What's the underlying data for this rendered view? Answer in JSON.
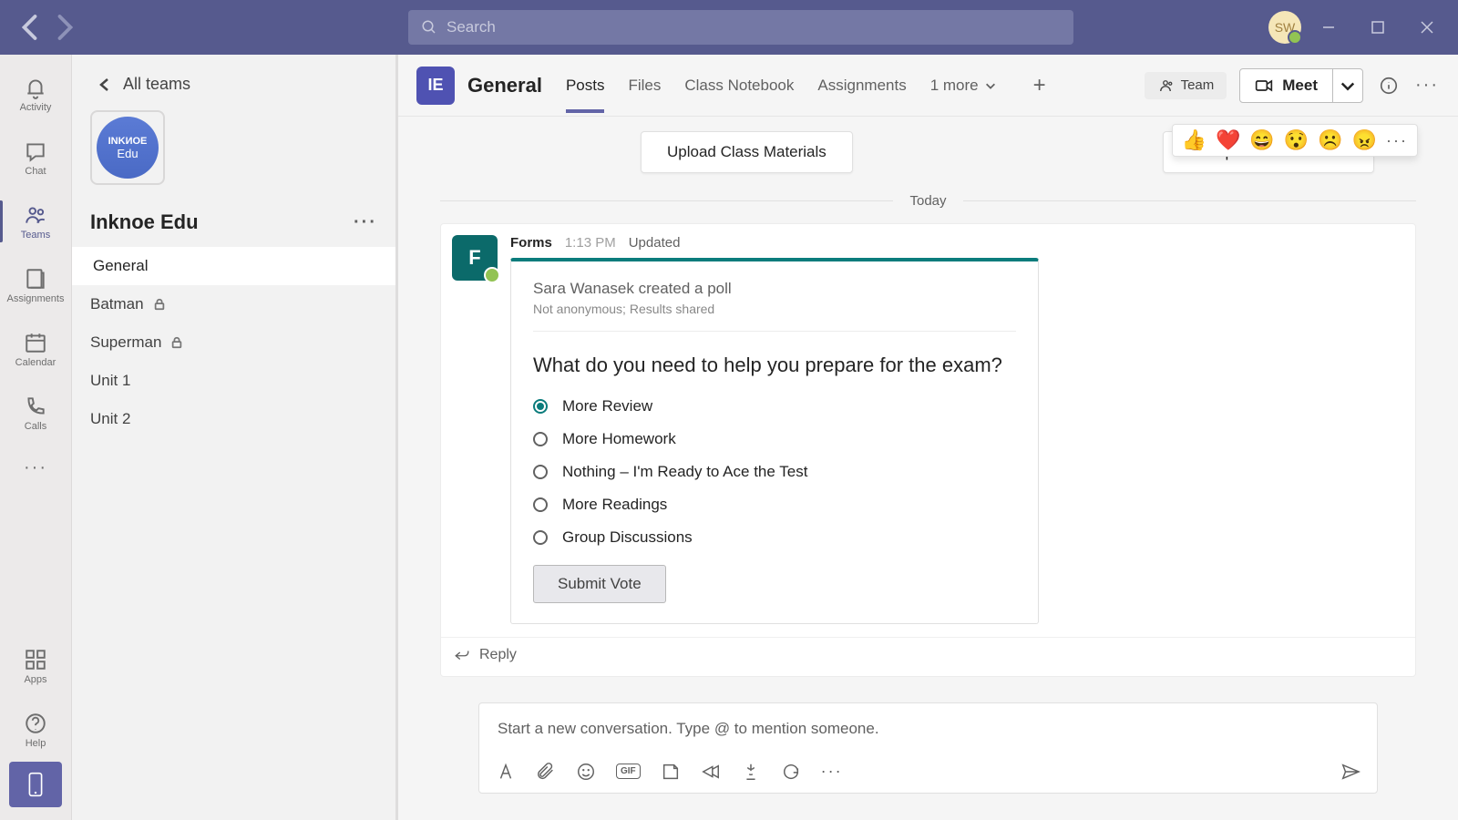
{
  "titlebar": {
    "search_placeholder": "Search",
    "user_initials": "SW"
  },
  "rail": {
    "activity": "Activity",
    "chat": "Chat",
    "teams": "Teams",
    "assignments": "Assignments",
    "calendar": "Calendar",
    "calls": "Calls",
    "apps": "Apps",
    "help": "Help"
  },
  "sidebar": {
    "all_teams": "All teams",
    "team_logo_top": "INKИOE",
    "team_logo_bottom": "Edu",
    "team_name": "Inknoe Edu",
    "channels": [
      {
        "label": "General",
        "locked": false
      },
      {
        "label": "Batman",
        "locked": true
      },
      {
        "label": "Superman",
        "locked": true
      },
      {
        "label": "Unit 1",
        "locked": false
      },
      {
        "label": "Unit 2",
        "locked": false
      }
    ]
  },
  "header": {
    "avatar_letter": "IE",
    "channel_title": "General",
    "tabs": {
      "posts": "Posts",
      "files": "Files",
      "notebook": "Class Notebook",
      "assignments": "Assignments"
    },
    "more_tabs": "1 more",
    "team_btn": "Team",
    "meet_btn": "Meet"
  },
  "body": {
    "upload_btn": "Upload Class Materials",
    "setup_btn": "Set up Class Notebook",
    "date_label": "Today"
  },
  "post": {
    "from": "Forms",
    "time": "1:13 PM",
    "updated": "Updated",
    "avatar_letter": "F",
    "poll_creator": "Sara Wanasek created a poll",
    "poll_sub": "Not anonymous; Results shared",
    "poll_question": "What do you need to help you prepare for the exam?",
    "options": [
      "More Review",
      "More Homework",
      "Nothing – I'm Ready to Ace the Test",
      "More Readings",
      "Group Discussions"
    ],
    "selected_index": 0,
    "submit_label": "Submit Vote",
    "reply": "Reply"
  },
  "reactions": {
    "emojis": [
      "👍",
      "❤️",
      "😄",
      "😯",
      "☹️",
      "😠"
    ]
  },
  "compose": {
    "placeholder": "Start a new conversation. Type @ to mention someone.",
    "gif": "GIF"
  }
}
